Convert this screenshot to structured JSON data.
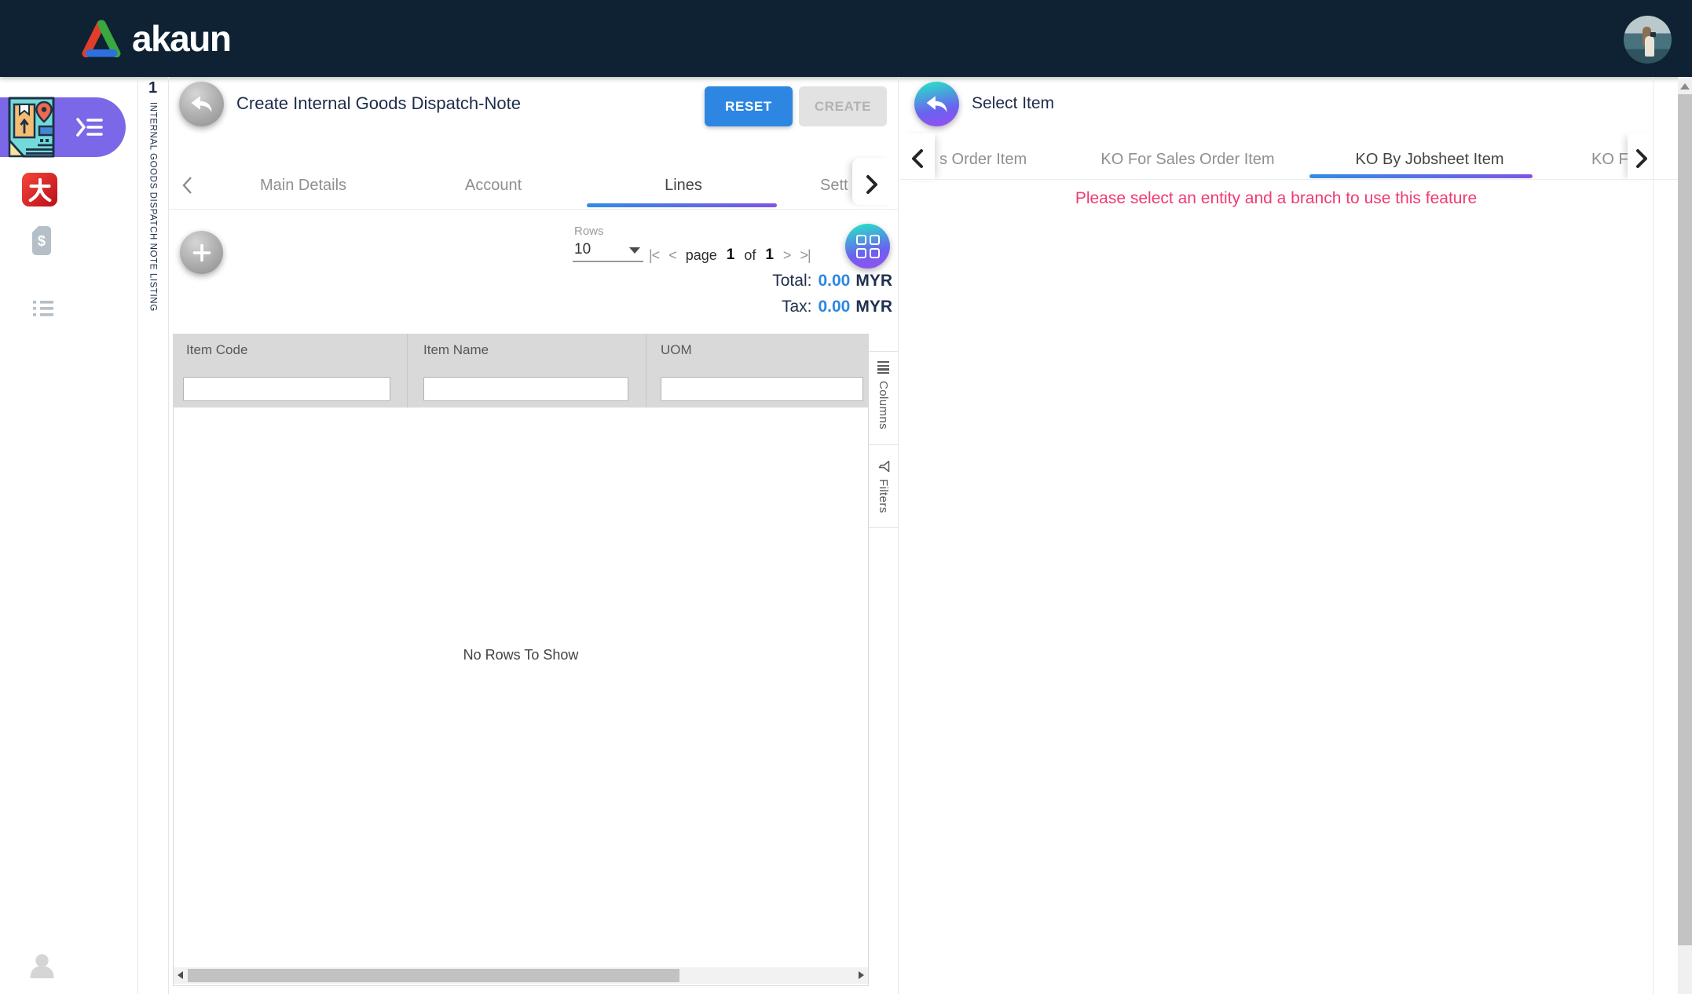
{
  "navbar": {
    "brand": "akaun"
  },
  "sidebar": {
    "icons": [
      "dispatch-note-app-icon",
      "da-app-icon",
      "billing-file-icon",
      "listing-icon"
    ],
    "footer_icon": "person-placeholder-icon"
  },
  "context_strip": {
    "badge": "1",
    "label": "INTERNAL GOODS DISPATCH NOTE LISTING"
  },
  "main_panel": {
    "title": "Create Internal Goods Dispatch-Note",
    "actions": {
      "reset": "RESET",
      "create": "CREATE"
    },
    "tabs": [
      "Main Details",
      "Account",
      "Lines",
      "Sett"
    ],
    "active_tab": "Lines",
    "toolbar": {
      "rows_label": "Rows",
      "rows_value": "10",
      "pagination": {
        "first": "|<",
        "prev": "<",
        "page_word": "page",
        "current_page": "1",
        "of_word": "of",
        "total_pages": "1",
        "next": ">",
        "last": ">|"
      }
    },
    "totals": {
      "total_label": "Total:",
      "total_value": "0.00",
      "total_currency": "MYR",
      "tax_label": "Tax:",
      "tax_value": "0.00",
      "tax_currency": "MYR"
    },
    "table": {
      "columns": [
        "Item Code",
        "Item Name",
        "UOM"
      ],
      "empty_message": "No Rows To Show"
    },
    "side_tools": {
      "columns": "Columns",
      "filters": "Filters"
    }
  },
  "right_panel": {
    "title": "Select Item",
    "tabs": [
      "s Order Item",
      "KO For Sales Order Item",
      "KO By Jobsheet Item",
      "KO Fo"
    ],
    "active_tab": "KO By Jobsheet Item",
    "notice": "Please select an entity and a branch to use this feature"
  },
  "colors": {
    "navbar_bg": "#0e2234",
    "accent_blue": "#2d87e2",
    "sidebar_active_purple": "#7b68e8",
    "gradient_teal": "#2bd9cb",
    "gradient_violet": "#9a4df4",
    "notice_pink": "#f13a72",
    "underline_from": "#2f8ce6",
    "underline_to": "#7e55e6"
  }
}
